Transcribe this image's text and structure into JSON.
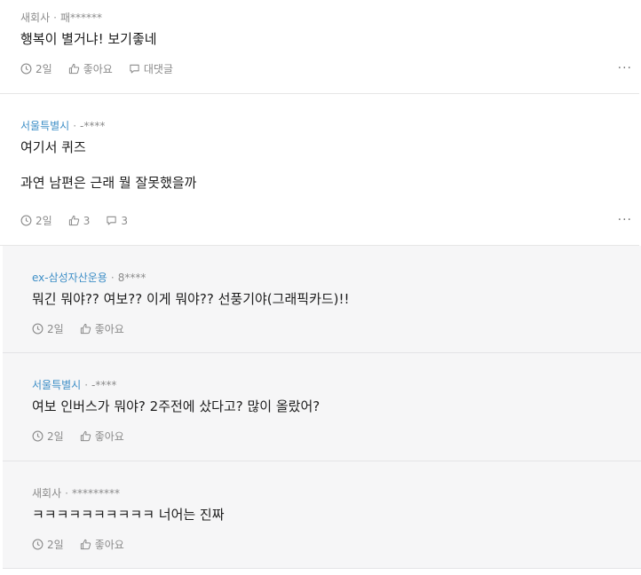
{
  "comments": [
    {
      "company": "새회사",
      "author": "패******",
      "text": "행복이 별거냐! 보기좋네",
      "time": "2일",
      "like_label": "좋아요",
      "reply_label": "대댓글",
      "more": "···"
    },
    {
      "company": "서울특별시",
      "author": "-****",
      "text": "여기서 퀴즈\n\n과연 남편은 근래 뭘 잘못했을까",
      "time": "2일",
      "like_label": "3",
      "reply_label": "3",
      "more": "···"
    }
  ],
  "replies": [
    {
      "company": "ex-삼성자산운용",
      "author": "8****",
      "text": "뭐긴 뭐야?? 여보?? 이게 뭐야?? 선풍기야(그래픽카드)!!",
      "time": "2일",
      "like_label": "좋아요"
    },
    {
      "company": "서울특별시",
      "author": "-****",
      "text": "여보 인버스가 뭐야? 2주전에 샀다고? 많이 올랐어?",
      "time": "2일",
      "like_label": "좋아요"
    },
    {
      "company": "새회사",
      "author": "*********",
      "text": "ㅋㅋㅋㅋㅋㅋㅋㅋㅋㅋ 너어는 진짜",
      "time": "2일",
      "like_label": "좋아요"
    }
  ],
  "colors": {
    "company_link": "#3f8fc7",
    "reply_bg": "#f6f6f7",
    "muted": "#8b8b8b"
  }
}
